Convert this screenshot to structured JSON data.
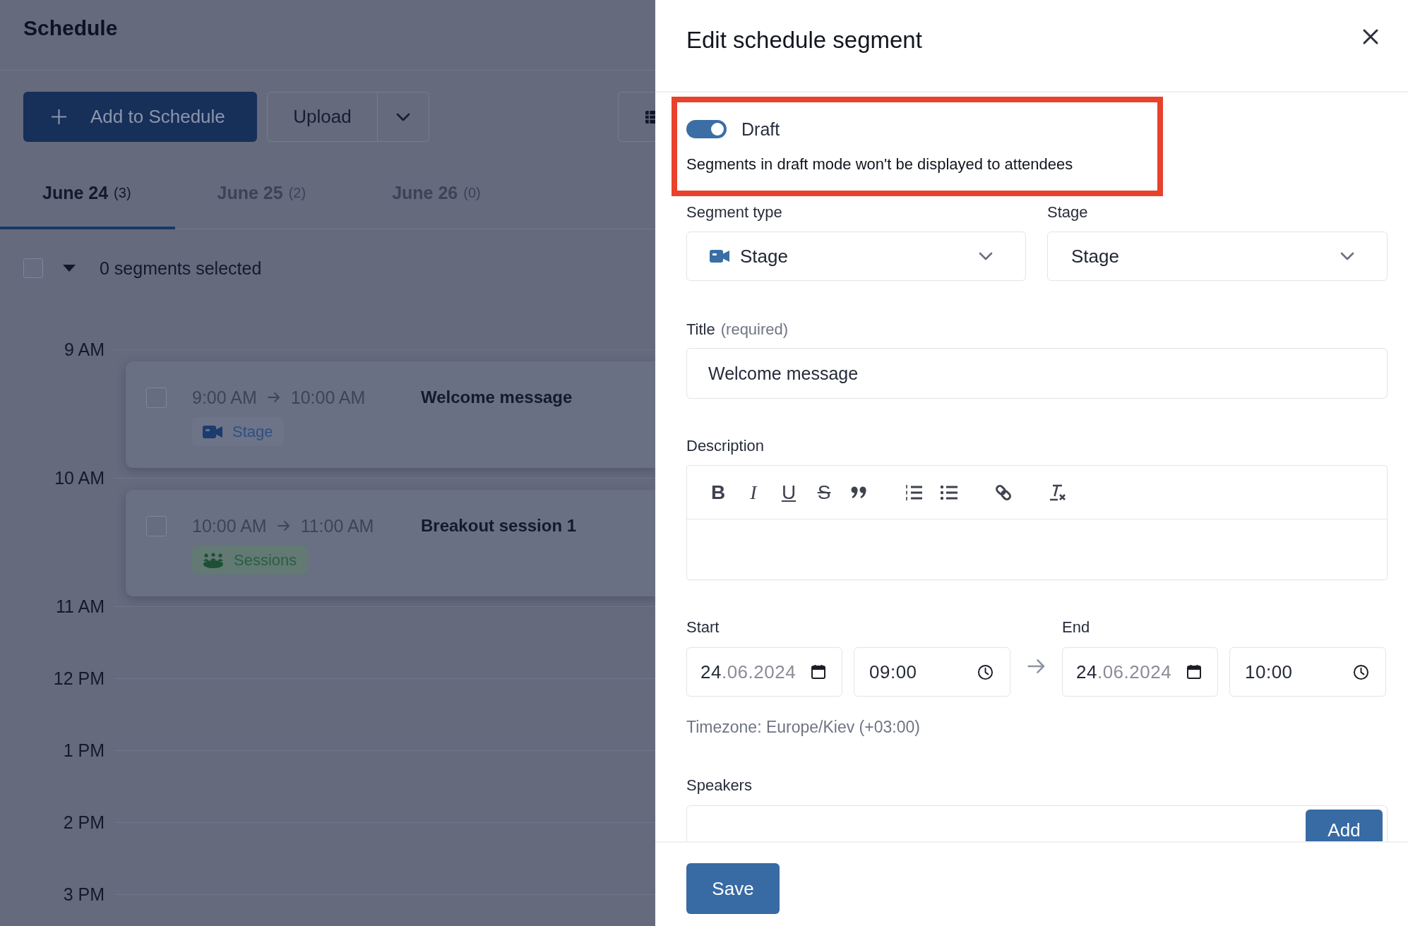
{
  "page": {
    "title": "Schedule"
  },
  "toolbar": {
    "add_button": "Add to Schedule",
    "upload_button": "Upload"
  },
  "tabs": [
    {
      "label": "June 24",
      "count": "(3)",
      "selected": true
    },
    {
      "label": "June 25",
      "count": "(2)",
      "selected": false
    },
    {
      "label": "June 26",
      "count": "(0)",
      "selected": false
    }
  ],
  "selection": {
    "checked": false,
    "label": "0 segments selected"
  },
  "timeline": [
    {
      "hour": "9 AM",
      "segments": [
        {
          "checked": false,
          "start": "9:00 AM",
          "end": "10:00 AM",
          "title": "Welcome message",
          "tag": {
            "kind": "stage",
            "label": "Stage"
          }
        }
      ]
    },
    {
      "hour": "10 AM",
      "segments": [
        {
          "checked": false,
          "start": "10:00 AM",
          "end": "11:00 AM",
          "title": "Breakout session 1",
          "tag": {
            "kind": "sessions",
            "label": "Sessions"
          }
        }
      ]
    },
    {
      "hour": "11 AM"
    },
    {
      "hour": "12 PM"
    },
    {
      "hour": "1 PM"
    },
    {
      "hour": "2 PM"
    },
    {
      "hour": "3 PM"
    }
  ],
  "panel": {
    "title": "Edit schedule segment",
    "draft": {
      "highlighted": true,
      "on": true,
      "label": "Draft",
      "hint": "Segments in draft mode won't be displayed to attendees"
    },
    "segment_type": {
      "label": "Segment type",
      "kind": "stage",
      "value": "Stage"
    },
    "stage": {
      "label": "Stage",
      "value": "Stage"
    },
    "title_field": {
      "label": "Title",
      "note": "(required)",
      "value": "Welcome message"
    },
    "description": {
      "label": "Description",
      "editor_tools": [
        [
          {
            "kind": "bold",
            "glyph": "B"
          },
          {
            "kind": "italic",
            "glyph": "I"
          },
          {
            "kind": "underline",
            "glyph": "U"
          },
          {
            "kind": "strike",
            "glyph": "S"
          },
          {
            "kind": "quote"
          }
        ],
        [
          {
            "kind": "ordered_list"
          },
          {
            "kind": "bullet_list"
          }
        ],
        [
          {
            "kind": "link"
          }
        ],
        [
          {
            "kind": "clear_format"
          }
        ]
      ]
    },
    "start": {
      "label": "Start",
      "date": "24.06.2024",
      "time": "09:00"
    },
    "end": {
      "label": "End",
      "date": "24.06.2024",
      "time": "10:00"
    },
    "timezone": "Timezone: Europe/Kiev (+03:00)",
    "speakers": {
      "label": "Speakers",
      "add_button": "Add"
    },
    "save_button": "Save"
  }
}
